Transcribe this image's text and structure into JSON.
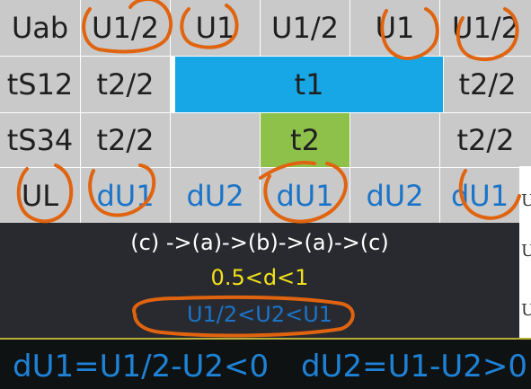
{
  "table": {
    "row1": {
      "c1": "Uab",
      "c2": "U1/2",
      "c3": "U1",
      "c4": "U1/2",
      "c5": "U1",
      "c6": "U1/2"
    },
    "row2": {
      "c1": "tS12",
      "c2": "t2/2",
      "center": "t1",
      "c6": "t2/2"
    },
    "row3": {
      "c1": "tS34",
      "c2": "t2/2",
      "green": "t2",
      "c6": "t2/2"
    },
    "row4": {
      "c1": "UL",
      "c2": "dU1",
      "c3": "dU2",
      "c4": "dU1",
      "c5": "dU2",
      "c6": "dU1"
    }
  },
  "side": {
    "a": "U",
    "b": "U",
    "c": "U"
  },
  "notes": {
    "sequence": "(c) ->(a)->(b)->(a)->(c)",
    "duty": "0.5<d<1",
    "range": "U1/2<U2<U1"
  },
  "equations": {
    "eq1": "dU1=U1/2-U2<0",
    "eq2": "dU2=U1-U2>0"
  },
  "colors": {
    "accent_blue": "#17a7e6",
    "green": "#8dc14a",
    "text_blue": "#1b74c8",
    "annotation": "#e0640f"
  }
}
